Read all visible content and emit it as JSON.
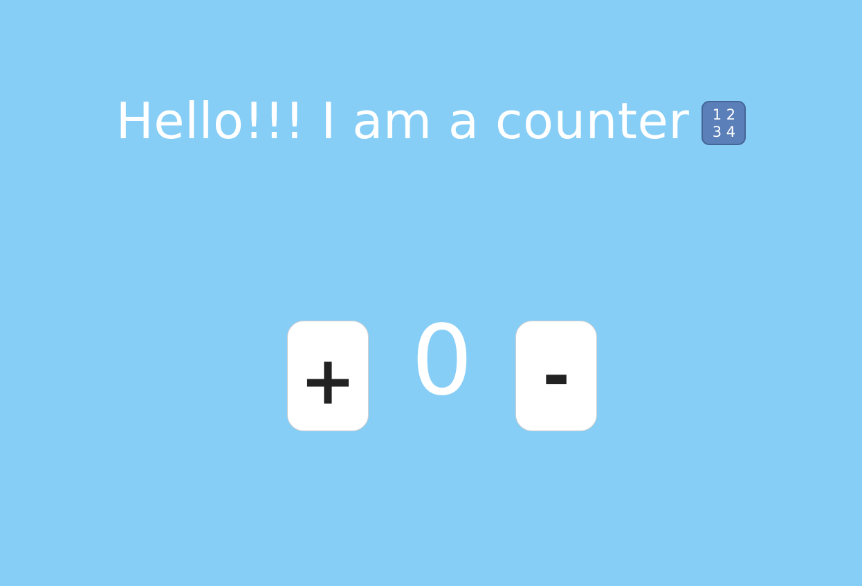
{
  "header": {
    "title": "Hello!!! I am a counter",
    "icon": "input-numbers-icon",
    "icon_digits": [
      "1",
      "2",
      "3",
      "4"
    ]
  },
  "counter": {
    "value": "0",
    "increment_label": "+",
    "decrement_label": "-"
  },
  "colors": {
    "background": "#87cef6",
    "text": "#ffffff",
    "button_background": "#ffffff",
    "button_text": "#222222",
    "icon_background": "#5b7fb8"
  }
}
